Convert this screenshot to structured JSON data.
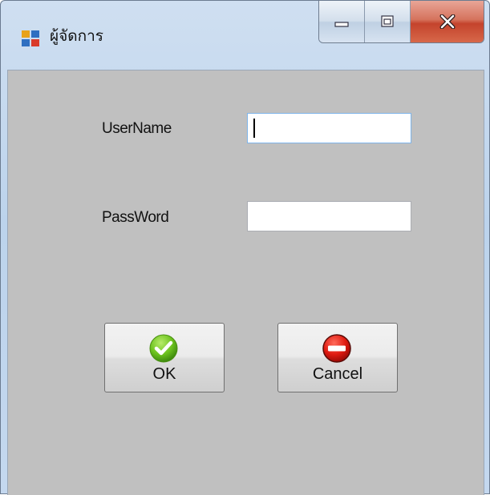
{
  "window": {
    "title": "ผู้จัดการ",
    "controls": [
      "minimize",
      "maximize",
      "close"
    ]
  },
  "form": {
    "username_label": "UserName",
    "username_value": "",
    "password_label": "PassWord",
    "password_value": ""
  },
  "buttons": {
    "ok_label": "OK",
    "cancel_label": "Cancel"
  },
  "icons": {
    "ok": "green-checkmark-icon",
    "cancel": "red-no-entry-icon"
  }
}
